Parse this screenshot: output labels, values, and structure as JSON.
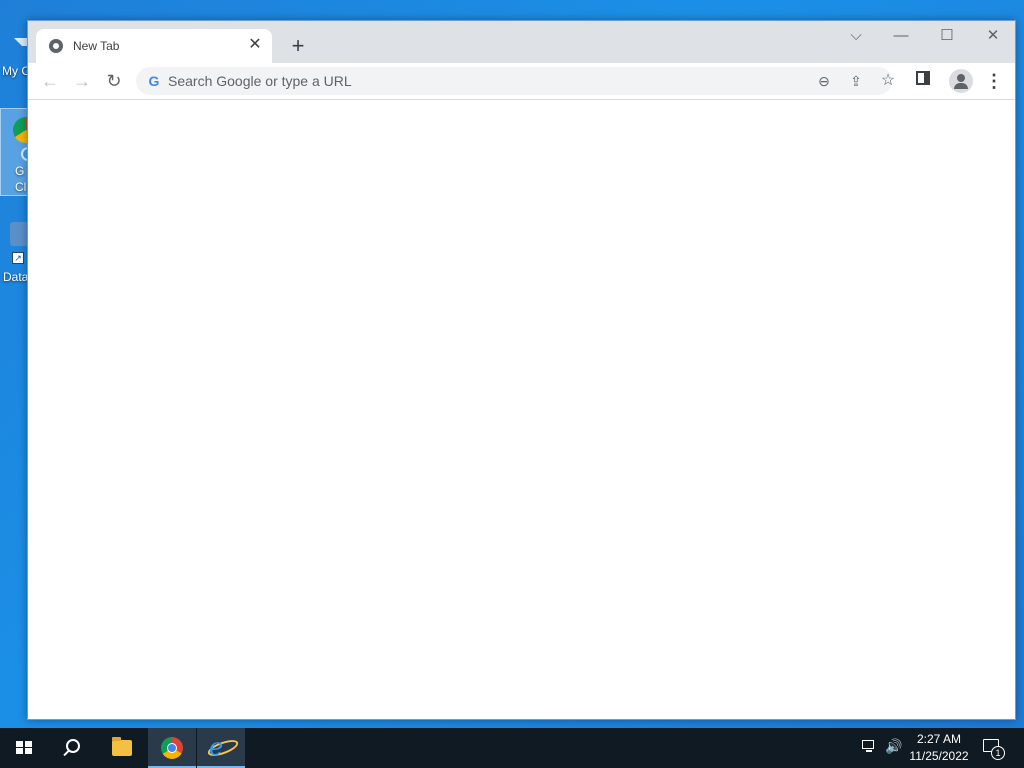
{
  "desktop": {
    "icons": [
      {
        "label": "My C",
        "icon": "computer-icon"
      },
      {
        "label": "G\nCl",
        "icon": "chrome-icon"
      },
      {
        "label": "Data",
        "icon": "data-shortcut-icon"
      }
    ]
  },
  "browser": {
    "tab": {
      "title": "New Tab",
      "favicon": "chrome-favicon-icon",
      "close_label": "✕"
    },
    "new_tab_label": "+",
    "window_controls": {
      "tab_search": "⌵",
      "minimize": "—",
      "maximize": "☐",
      "close": "✕"
    },
    "toolbar": {
      "back": "←",
      "forward": "→",
      "reload": "↻"
    },
    "omnibox": {
      "placeholder": "Search Google or type a URL",
      "value": "",
      "google_glyph": "G"
    },
    "omnibox_icons": {
      "zoom": "⊖",
      "share": "⇪",
      "bookmark": "☆"
    },
    "menu_glyph": "⋮"
  },
  "taskbar": {
    "volume_glyph": "🔊",
    "clock": {
      "time": "2:27 AM",
      "date": "11/25/2022"
    },
    "notifications_count": "1"
  },
  "colors": {
    "desktop_bg": "#1b8fe6",
    "taskbar_bg": "#101a22",
    "tabstrip_bg": "#dee1e6",
    "omnibox_bg": "#f1f3f4",
    "active_indicator": "#76b9ed"
  }
}
